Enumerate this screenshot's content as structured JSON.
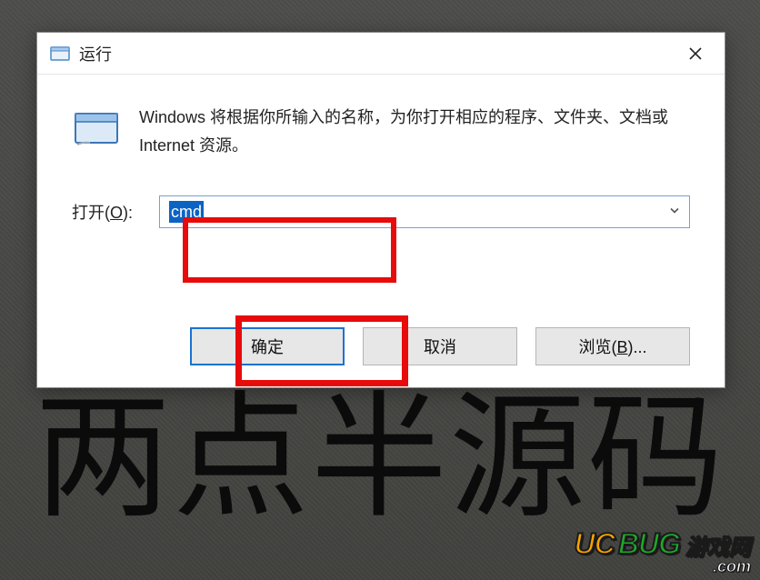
{
  "dialog": {
    "title": "运行",
    "description": "Windows 将根据你所输入的名称，为你打开相应的程序、文件夹、文档或 Internet 资源。",
    "open_label_prefix": "打开(",
    "open_label_key": "O",
    "open_label_suffix": "):",
    "input_value": "cmd",
    "buttons": {
      "ok": "确定",
      "cancel": "取消",
      "browse_prefix": "浏览(",
      "browse_key": "B",
      "browse_suffix": ")..."
    }
  },
  "watermark": "两点半源码",
  "logo": {
    "part1": "UC",
    "part2": "BUG",
    "part3": "游戏网",
    "sub": ".com"
  }
}
